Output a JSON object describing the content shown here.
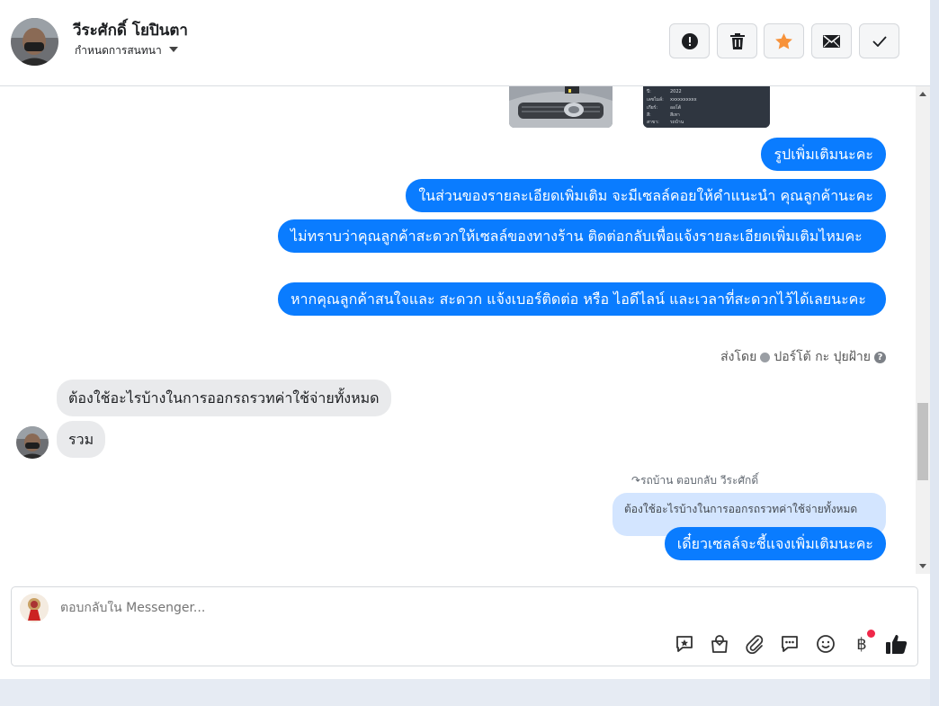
{
  "header": {
    "contact_name": "วีระศักดิ์ โยปินตา",
    "assign_label": "กำหนดการสนทนา",
    "actions": [
      {
        "name": "report-spam",
        "icon": "exclamation-circle-icon"
      },
      {
        "name": "delete",
        "icon": "trash-icon"
      },
      {
        "name": "star",
        "icon": "star-icon",
        "color": "#f7923a"
      },
      {
        "name": "mark-unread",
        "icon": "envelope-icon"
      },
      {
        "name": "mark-done",
        "icon": "checkmark-icon"
      }
    ]
  },
  "messages": {
    "out_1": "รูปเพิ่มเติมนะคะ",
    "out_2": "ในส่วนของรายละเอียดเพิ่มเติม จะมีเซลล์คอยให้คำแนะนำ คุณลูกค้านะคะ",
    "out_3": "ไม่ทราบว่าคุณลูกค้าสะดวกให้เซลล์ของทางร้าน ติดต่อกลับเพื่อแจ้งรายละเอียดเพิ่มเติมไหมคะ",
    "out_4": "หากคุณลูกค้าสนใจและ สะดวก แจ้งเบอร์ติดต่อ หรือ ไอดีไลน์ และเวลาที่สะดวกไว้ได้เลยนะคะ",
    "sent_by_label": "ส่งโดย",
    "sent_by_name": "ปอร์โต้ กะ ปุยฝ้าย",
    "in_1": "ต้องใช้อะไรบ้างในการออกรถรวทค่าใช้จ่ายทั้งหมด",
    "in_2": "รวม",
    "reply_header": "รถบ้าน ตอบกลับ วีระศักดิ์",
    "quoted_text": "ต้องใช้อะไรบ้างในการออกรถรวทค่าใช้จ่ายทั้งหมด",
    "out_5": "เดี๋ยวเซลล์จะชี้แจงเพิ่มเติมนะคะ"
  },
  "car_info": {
    "rows": [
      {
        "k": "ปี:",
        "v": "2022"
      },
      {
        "k": "เลขไมล์:",
        "v": "xxxxxxxxxx"
      },
      {
        "k": "เกียร์:",
        "v": "ออโต้"
      },
      {
        "k": "สี:",
        "v": "สีเทา"
      },
      {
        "k": "สาขา:",
        "v": "รถบ้าน"
      }
    ]
  },
  "composer": {
    "placeholder": "ตอบกลับใน Messenger...",
    "tools": [
      "saved-reply-icon",
      "shop-bag-icon",
      "attachment-icon",
      "chat-bubble-icon",
      "emoji-icon",
      "baht-payment-icon",
      "thumbs-up-icon"
    ],
    "baht_symbol": "฿"
  },
  "colors": {
    "outgoing_bubble": "#0a7cff",
    "incoming_bubble": "#e9eaec",
    "quoted_bubble": "#d3e5ff",
    "notification_dot": "#f02849"
  }
}
